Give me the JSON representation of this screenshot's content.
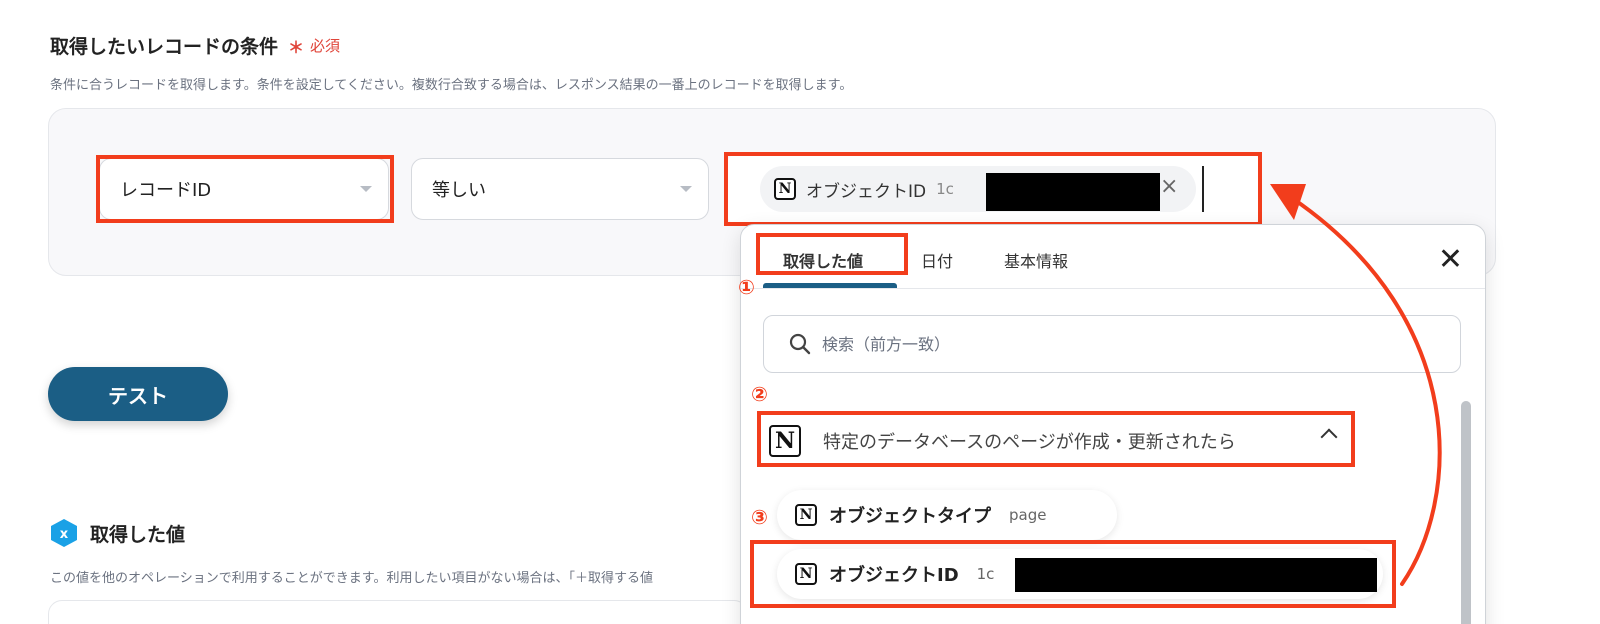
{
  "section": {
    "title": "取得したいレコードの条件",
    "required_star": "＊",
    "required_label": "必須",
    "description": "条件に合うレコードを取得します。条件を設定してください。複数行合致する場合は、レスポンス結果の一番上のレコードを取得します。"
  },
  "condition": {
    "field_value": "レコードID",
    "operator_value": "等しい",
    "value_chip_label": "オブジェクトID",
    "value_chip_prefix": "1c"
  },
  "test_button_label": "テスト",
  "acquired": {
    "title": "取得した値",
    "icon_letter": "x",
    "description": "この値を他のオペレーションで利用することができます。利用したい項目がない場合は、「＋取得する値"
  },
  "dropdown": {
    "tabs": [
      {
        "label": "取得した値"
      },
      {
        "label": "日付"
      },
      {
        "label": "基本情報"
      }
    ],
    "search_placeholder": "検索（前方一致）",
    "group_label": "特定のデータベースのページが作成・更新されたら",
    "items": [
      {
        "label": "オブジェクトタイプ",
        "value": "page"
      },
      {
        "label": "オブジェクトID",
        "value": "1c"
      }
    ]
  },
  "annotations": {
    "step1": "①",
    "step2": "②",
    "step3": "③"
  },
  "icons": {
    "notion": "N",
    "close": "✕",
    "close_small": "×"
  },
  "colors": {
    "accent": "#1b5e85",
    "annotation_red": "#f23d1c",
    "required_red": "#e0453a"
  }
}
